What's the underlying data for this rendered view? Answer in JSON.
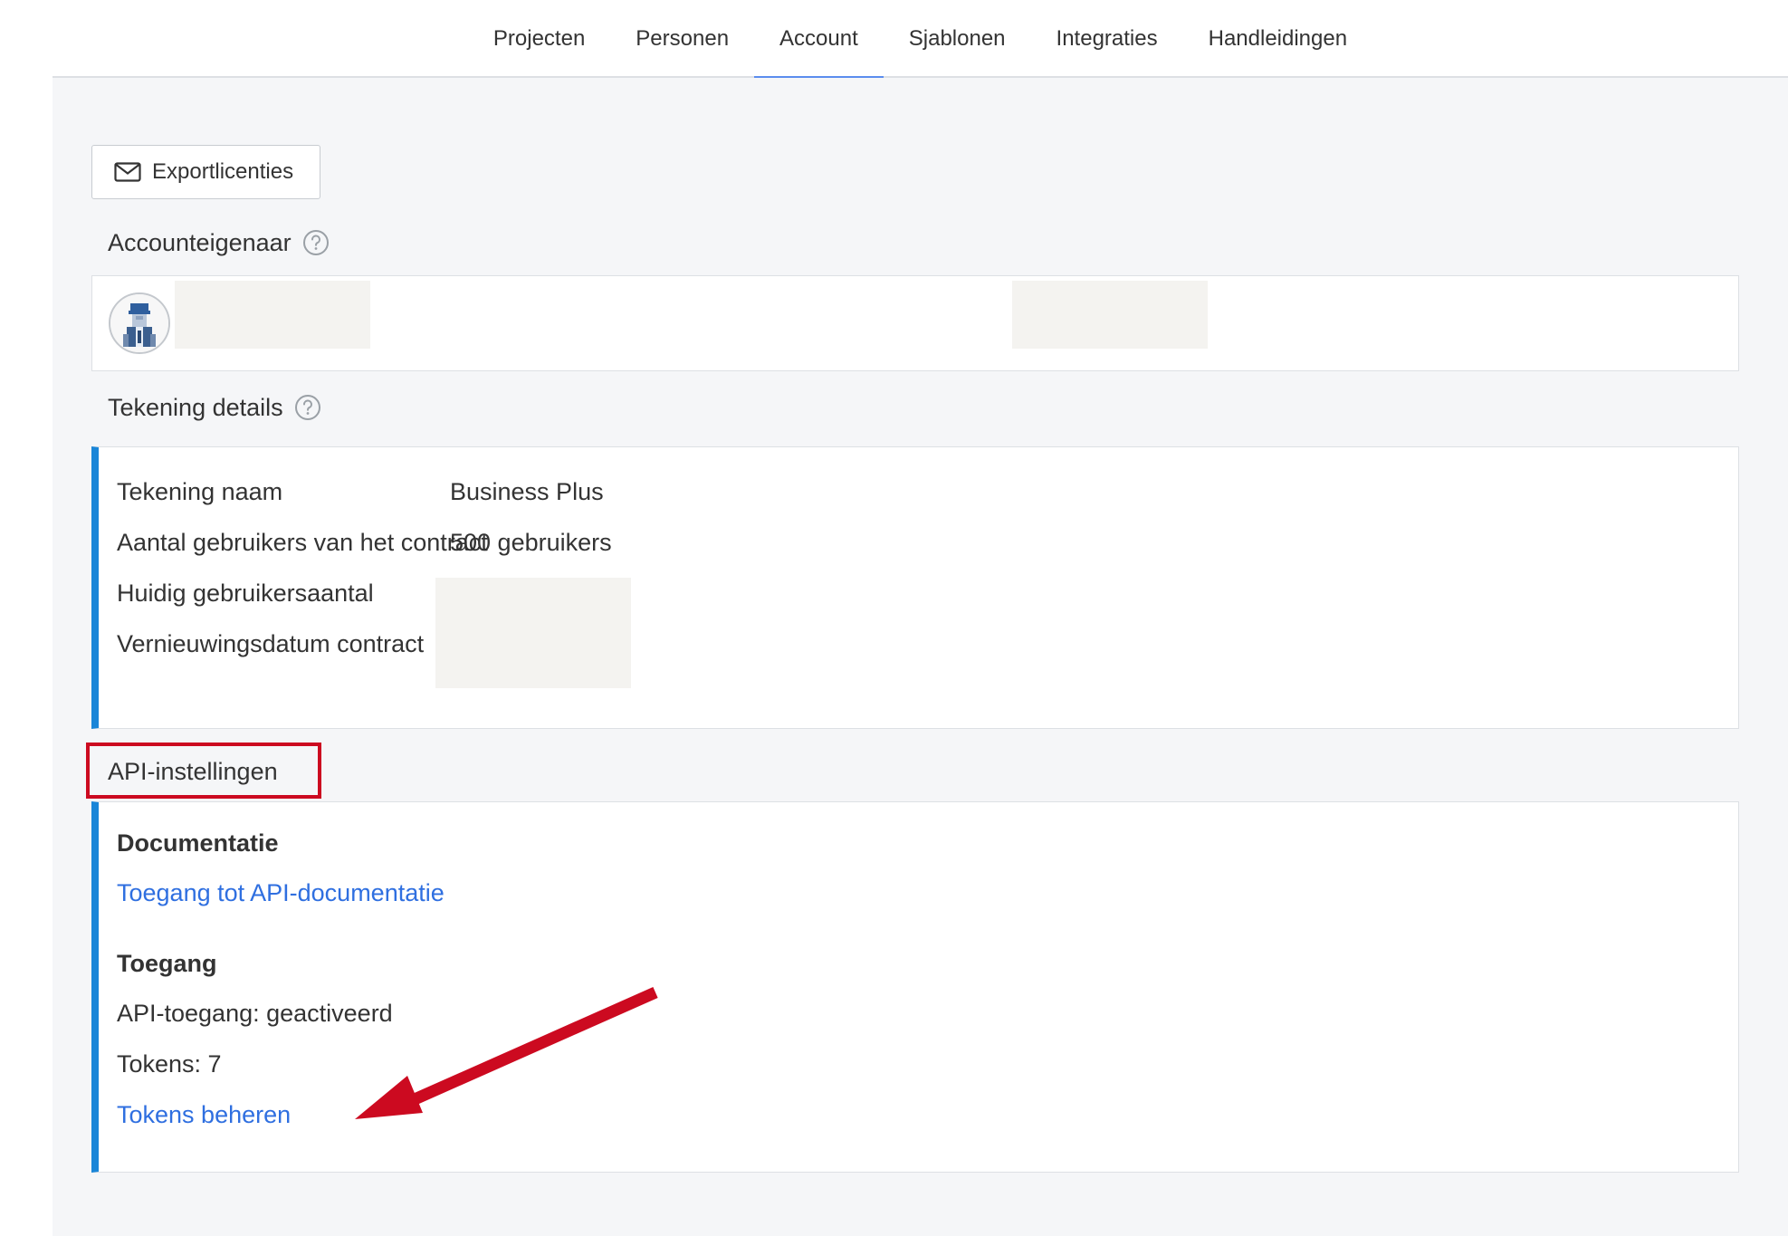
{
  "nav": {
    "tabs": [
      {
        "label": "Projecten"
      },
      {
        "label": "Personen"
      },
      {
        "label": "Account"
      },
      {
        "label": "Sjablonen"
      },
      {
        "label": "Integraties"
      },
      {
        "label": "Handleidingen"
      }
    ],
    "active_tab": "Account"
  },
  "toolbar": {
    "export_label": "Exportlicenties",
    "export_icon": "mail-icon"
  },
  "owner": {
    "title": "Accounteigenaar"
  },
  "subscription": {
    "title": "Tekening details",
    "rows": [
      {
        "label": "Tekening naam",
        "value": "Business Plus"
      },
      {
        "label": "Aantal gebruikers van het contract",
        "value": "500 gebruikers"
      },
      {
        "label": "Huidig gebruikersaantal",
        "value": ""
      },
      {
        "label": "Vernieuwingsdatum contract",
        "value": ""
      }
    ]
  },
  "api": {
    "title": "API-instellingen",
    "documentation_heading": "Documentatie",
    "documentation_link": "Toegang tot API-documentatie",
    "access_heading": "Toegang",
    "access_status": "API-toegang: geactiveerd",
    "tokens_count": "Tokens: 7",
    "manage_tokens_link": "Tokens beheren"
  },
  "colors": {
    "accent": "#1a86d8",
    "active_tab": "#5b8dee",
    "link": "#2f6fe0",
    "annotation": "#cc0a20"
  }
}
